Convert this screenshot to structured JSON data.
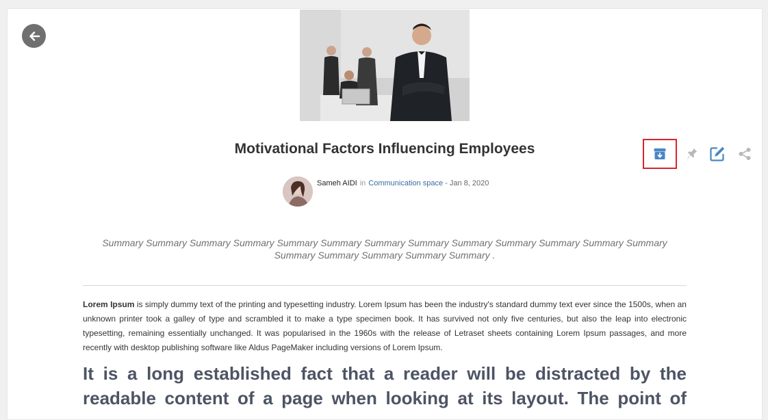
{
  "article": {
    "title": "Motivational Factors Influencing Employees",
    "author": "Sameh AIDI",
    "in_label": "in",
    "space": "Communication space",
    "date": "- Jan 8, 2020",
    "summary": "Summary Summary Summary Summary Summary Summary Summary Summary Summary Summary Summary Summary Summary Summary Summary Summary Summary Summary .",
    "body_bold": "Lorem Ipsum",
    "body_rest": " is simply dummy text of the printing and typesetting industry. Lorem Ipsum has been the industry's standard dummy text ever since the 1500s, when an unknown printer took a galley of type and scrambled it to make a type specimen book. It has survived not only five centuries, but also the leap into electronic typesetting, remaining essentially unchanged. It was popularised in the 1960s with the release of Letraset sheets containing Lorem Ipsum passages, and more recently with desktop publishing software like Aldus PageMaker including versions of Lorem Ipsum.",
    "heading": "It is a long established fact that a reader will be distracted by the readable content of a page when looking at its layout. The point of"
  },
  "icons": {
    "back": "arrow-left-icon",
    "archive": "archive-icon",
    "pin": "pin-icon",
    "edit": "edit-icon",
    "share": "share-icon"
  },
  "colors": {
    "accent": "#4a86c5",
    "highlight_border": "#d8232a",
    "back_button_bg": "#707070",
    "muted_icon": "#b8b8b8",
    "heading": "#4d5464"
  }
}
